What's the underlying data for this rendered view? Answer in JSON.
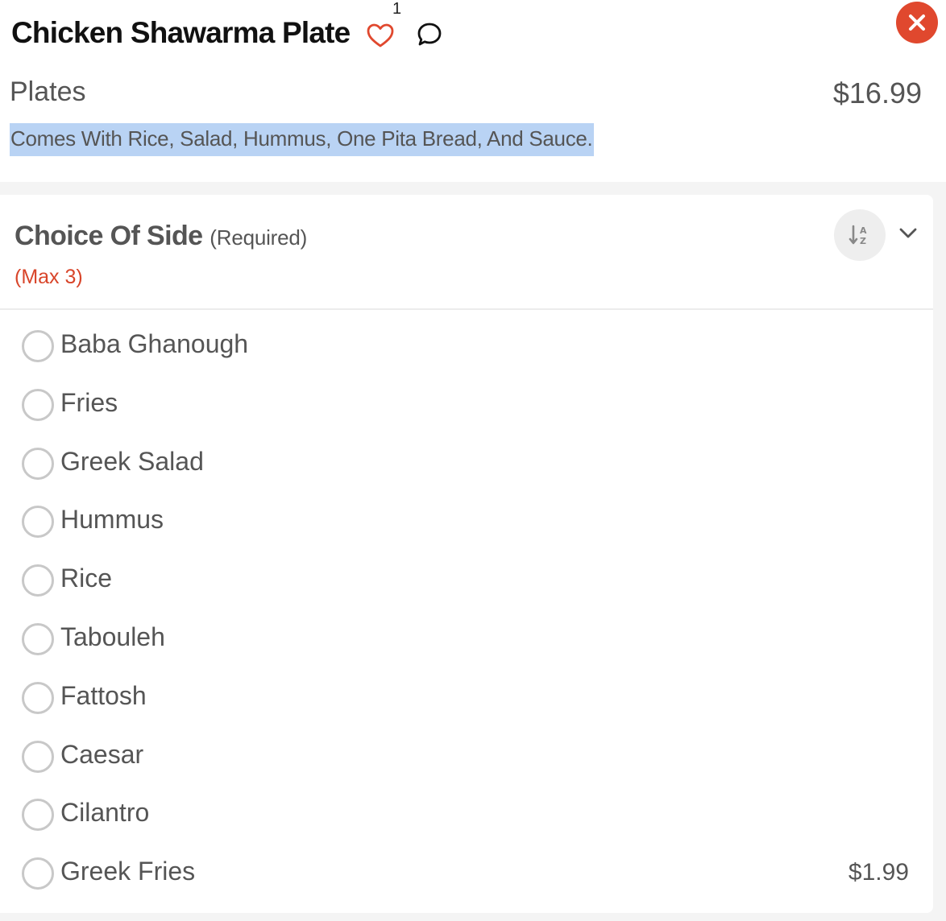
{
  "item": {
    "title": "Chicken Shawarma Plate",
    "favorite_count": "1",
    "category": "Plates",
    "price": "$16.99",
    "description": "Comes With Rice, Salad, Hummus, One Pita Bread, And Sauce."
  },
  "icons": {
    "favorite": "heart-outline-icon",
    "comment": "speech-bubble-icon",
    "close": "close-x-icon",
    "sort": "sort-alpha-icon",
    "collapse": "chevron-down-icon"
  },
  "colors": {
    "accent_red": "#e0482e",
    "required_red": "#d8452a",
    "selection_highlight": "#b9d3f4",
    "text_gray": "#555555"
  },
  "section": {
    "title": "Choice Of Side",
    "required": "(Required)",
    "max": "(Max 3)",
    "options": [
      {
        "label": "Baba Ghanough",
        "price": ""
      },
      {
        "label": "Fries",
        "price": ""
      },
      {
        "label": "Greek Salad",
        "price": ""
      },
      {
        "label": "Hummus",
        "price": ""
      },
      {
        "label": "Rice",
        "price": ""
      },
      {
        "label": "Tabouleh",
        "price": ""
      },
      {
        "label": "Fattosh",
        "price": ""
      },
      {
        "label": "Caesar",
        "price": ""
      },
      {
        "label": "Cilantro",
        "price": ""
      },
      {
        "label": "Greek Fries",
        "price": "$1.99"
      }
    ]
  }
}
